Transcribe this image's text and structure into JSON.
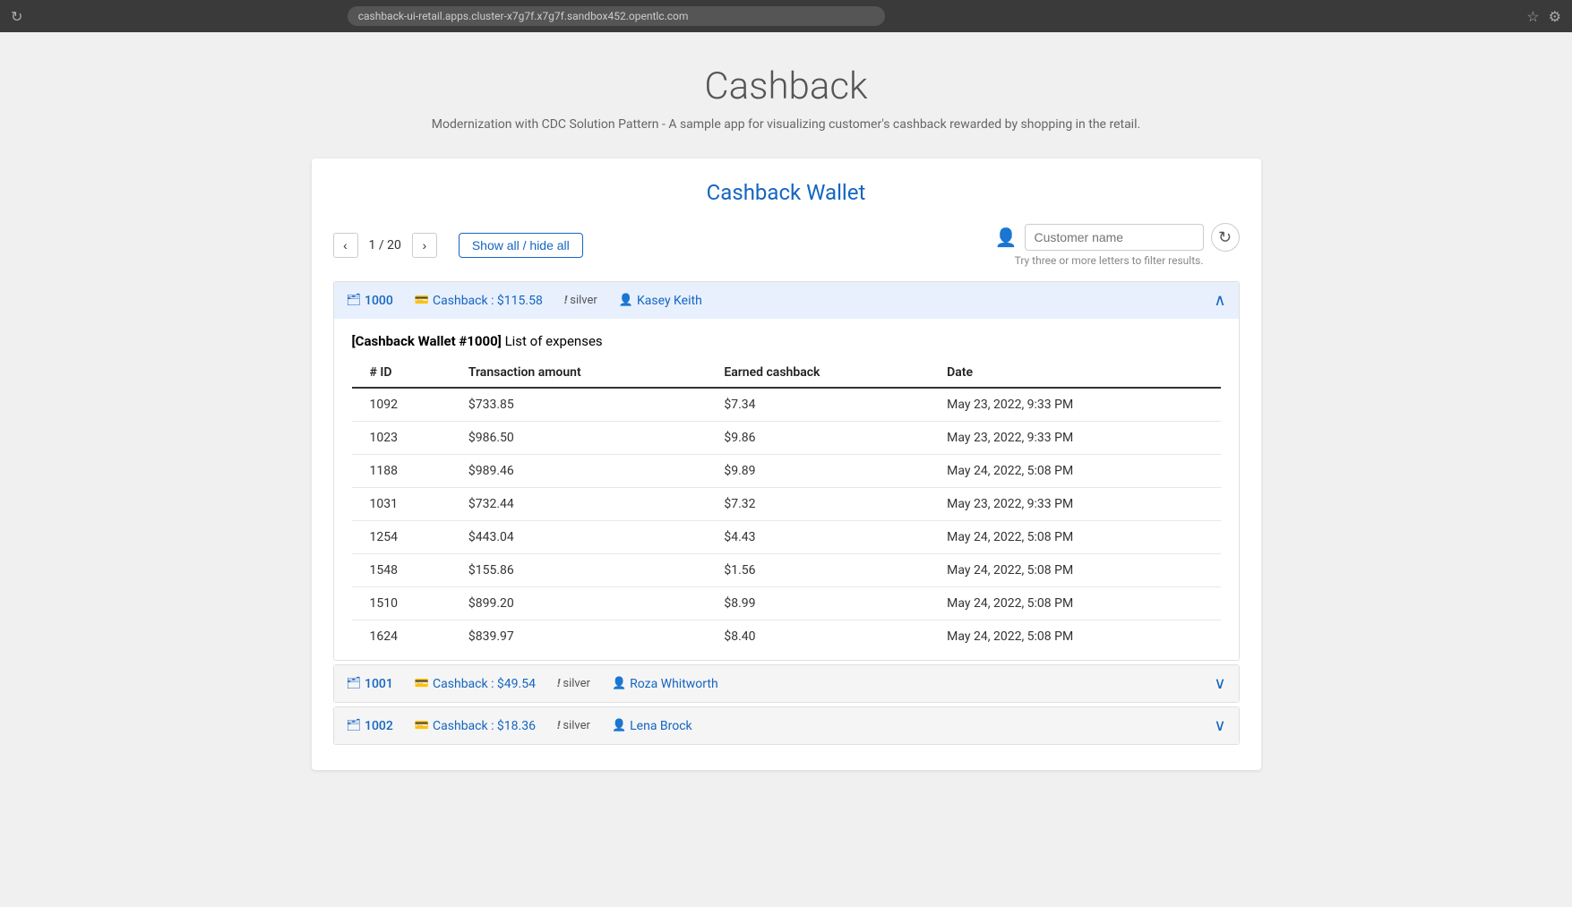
{
  "browser": {
    "url": "cashback-ui-retail.apps.cluster-x7g7f.x7g7f.sandbox452.opentlc.com"
  },
  "page": {
    "title": "Cashback",
    "subtitle": "Modernization with CDC Solution Pattern - A sample app for visualizing customer's cashback rewarded by shopping in the retail."
  },
  "wallet_section": {
    "title": "Cashback Wallet",
    "pagination": {
      "current": "1 / 20"
    },
    "show_hide_label": "Show all / hide all",
    "search_placeholder": "Customer name",
    "filter_hint": "Try three or more letters to filter results."
  },
  "wallets": [
    {
      "id": "1000",
      "cashback": "Cashback : $115.58",
      "tier": "silver",
      "customer": "Kasey Keith",
      "expanded": true,
      "body_title_bold": "[Cashback Wallet #1000]",
      "body_title_rest": " List of expenses",
      "expenses": [
        {
          "id": "1092",
          "amount": "$733.85",
          "earned": "$7.34",
          "date": "May 23, 2022, 9:33 PM"
        },
        {
          "id": "1023",
          "amount": "$986.50",
          "earned": "$9.86",
          "date": "May 23, 2022, 9:33 PM"
        },
        {
          "id": "1188",
          "amount": "$989.46",
          "earned": "$9.89",
          "date": "May 24, 2022, 5:08 PM"
        },
        {
          "id": "1031",
          "amount": "$732.44",
          "earned": "$7.32",
          "date": "May 23, 2022, 9:33 PM"
        },
        {
          "id": "1254",
          "amount": "$443.04",
          "earned": "$4.43",
          "date": "May 24, 2022, 5:08 PM"
        },
        {
          "id": "1548",
          "amount": "$155.86",
          "earned": "$1.56",
          "date": "May 24, 2022, 5:08 PM"
        },
        {
          "id": "1510",
          "amount": "$899.20",
          "earned": "$8.99",
          "date": "May 24, 2022, 5:08 PM"
        },
        {
          "id": "1624",
          "amount": "$839.97",
          "earned": "$8.40",
          "date": "May 24, 2022, 5:08 PM"
        }
      ],
      "columns": {
        "id": "# ID",
        "amount": "Transaction amount",
        "earned": "Earned cashback",
        "date": "Date"
      }
    },
    {
      "id": "1001",
      "cashback": "Cashback : $49.54",
      "tier": "silver",
      "customer": "Roza Whitworth",
      "expanded": false
    },
    {
      "id": "1002",
      "cashback": "Cashback : $18.36",
      "tier": "silver",
      "customer": "Lena Brock",
      "expanded": false
    }
  ]
}
